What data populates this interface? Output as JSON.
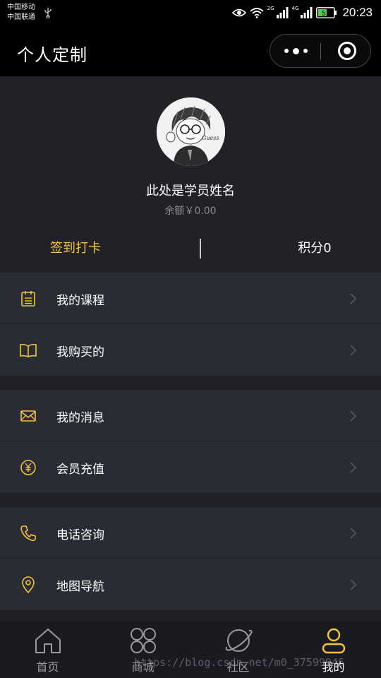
{
  "status_bar": {
    "carrier_1": "中国移动",
    "carrier_2": "中国联通",
    "net_tag_1": "2G",
    "net_tag_2": "4G",
    "battery": "51",
    "time": "20:23"
  },
  "nav": {
    "title": "个人定制"
  },
  "profile": {
    "avatar_caption": "Guess",
    "name": "此处是学员姓名",
    "balance": "余额￥0.00"
  },
  "actions": {
    "checkin": "签到打卡",
    "points": "积分0"
  },
  "menu_groups": [
    {
      "items": [
        {
          "label": "我的课程",
          "icon": "calendar-icon"
        },
        {
          "label": "我购买的",
          "icon": "book-icon"
        }
      ]
    },
    {
      "items": [
        {
          "label": "我的消息",
          "icon": "mail-icon"
        },
        {
          "label": "会员充值",
          "icon": "yen-icon"
        }
      ]
    },
    {
      "items": [
        {
          "label": "电话咨询",
          "icon": "phone-icon"
        },
        {
          "label": "地图导航",
          "icon": "location-pin-icon"
        }
      ]
    }
  ],
  "tabs": [
    {
      "label": "首页",
      "icon": "home-icon"
    },
    {
      "label": "商城",
      "icon": "grid-icon"
    },
    {
      "label": "社区",
      "icon": "planet-icon"
    },
    {
      "label": "我的",
      "icon": "user-icon"
    }
  ],
  "active_tab_index": 3,
  "colors": {
    "accent": "#f4c53a",
    "background": "#202127",
    "card": "#2a2c33",
    "bar": "#000000"
  },
  "watermark": "https://blog.csdn.net/m0_37599946"
}
